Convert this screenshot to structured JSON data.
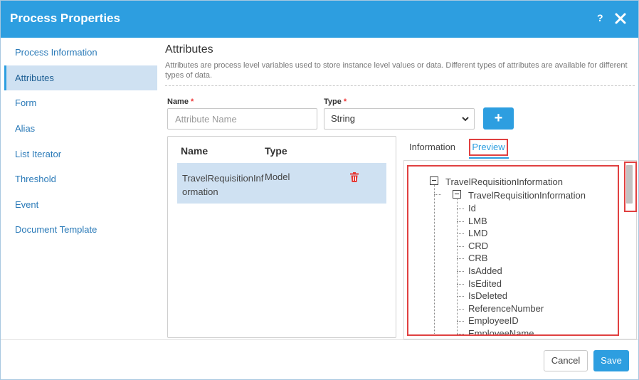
{
  "dialog": {
    "title": "Process Properties",
    "help_label": "?"
  },
  "sidebar": {
    "items": [
      {
        "label": "Process Information"
      },
      {
        "label": "Attributes"
      },
      {
        "label": "Form"
      },
      {
        "label": "Alias"
      },
      {
        "label": "List Iterator"
      },
      {
        "label": "Threshold"
      },
      {
        "label": "Event"
      },
      {
        "label": "Document Template"
      }
    ],
    "active_item": "Attributes"
  },
  "main": {
    "title": "Attributes",
    "description": "Attributes are process level variables used to store instance level values or data. Different types of attributes are available for different types of data.",
    "form": {
      "name_label": "Name",
      "name_placeholder": "Attribute Name",
      "type_label": "Type",
      "type_value": "String",
      "required_mark": "*",
      "add_button_label": "+"
    },
    "grid": {
      "headers": {
        "name": "Name",
        "type": "Type"
      },
      "rows": [
        {
          "name": "TravelRequisitionInformation",
          "type": "Model"
        }
      ]
    },
    "tabs": [
      {
        "label": "Information"
      },
      {
        "label": "Preview"
      }
    ],
    "active_tab": "Preview",
    "tree": {
      "root": "TravelRequisitionInformation",
      "child": "TravelRequisitionInformation",
      "fields": [
        "Id",
        "LMB",
        "LMD",
        "CRD",
        "CRB",
        "IsAdded",
        "IsEdited",
        "IsDeleted",
        "ReferenceNumber",
        "EmployeeID",
        "EmployeeName"
      ]
    }
  },
  "footer": {
    "cancel_label": "Cancel",
    "save_label": "Save"
  },
  "colors": {
    "accent": "#2d9ee0",
    "highlight_border": "#e04040",
    "selected_row": "#cfe1f2",
    "delete_icon": "#e53935"
  }
}
